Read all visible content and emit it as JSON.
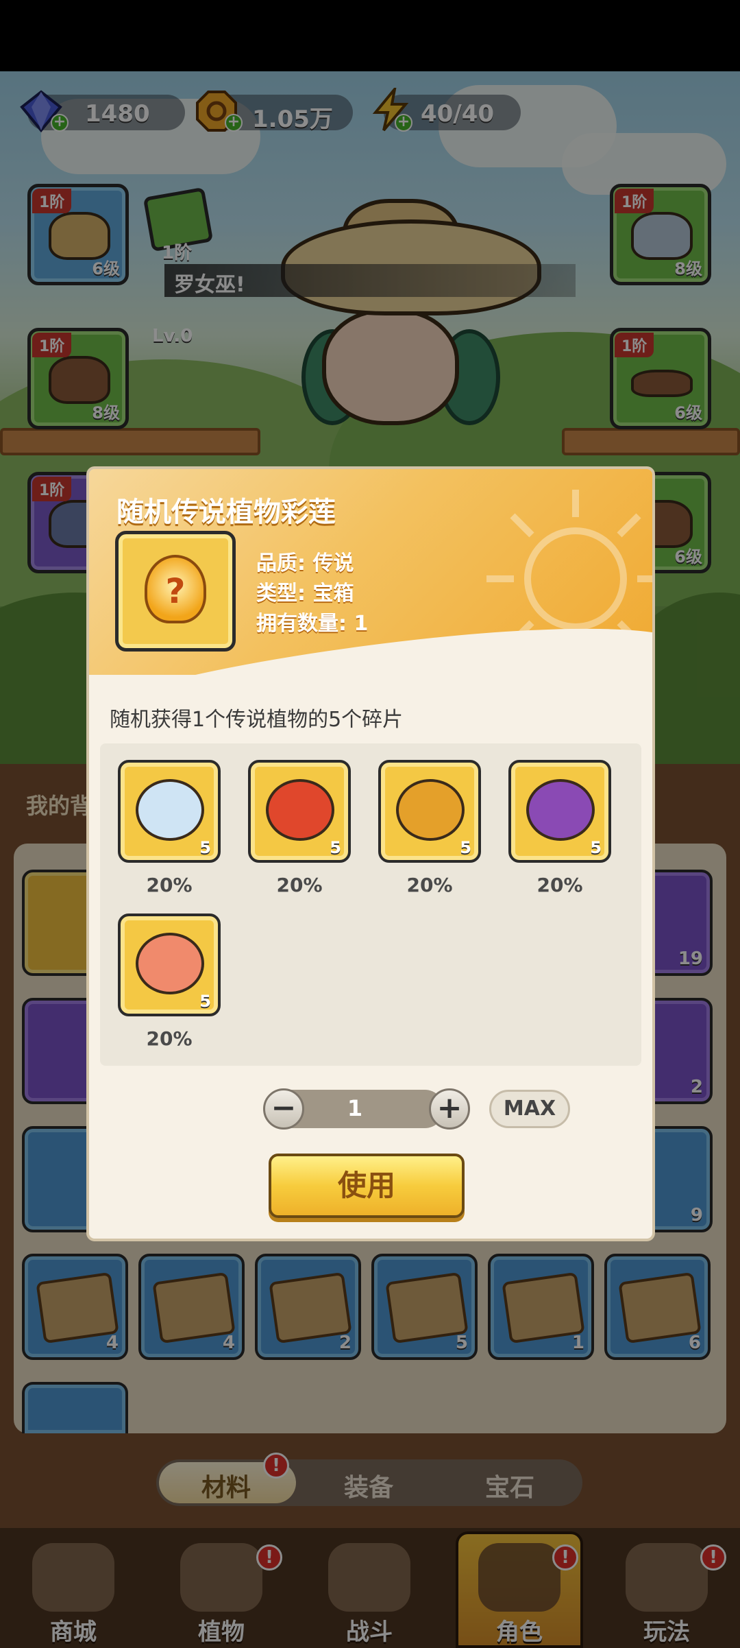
{
  "resources": {
    "diamonds": "1480",
    "coins": "1.05万",
    "energy": "40/40"
  },
  "character": {
    "name_banner": "罗女巫!",
    "side_item_tier": "1阶",
    "side_item_level": "Lv.0"
  },
  "equipment_left": [
    {
      "tier": "1阶",
      "level": "6级",
      "icon": "straw-hat-icon",
      "color": "blue"
    },
    {
      "tier": "1阶",
      "level": "8级",
      "icon": "glove-icon",
      "color": "green"
    },
    {
      "tier": "1阶",
      "level": "",
      "icon": "pants-icon",
      "color": "purple"
    }
  ],
  "equipment_right": [
    {
      "tier": "1阶",
      "level": "8级",
      "icon": "overalls-icon",
      "color": "green"
    },
    {
      "tier": "1阶",
      "level": "6级",
      "icon": "belt-icon",
      "color": "green"
    },
    {
      "tier": "",
      "level": "6级",
      "icon": "boots-icon",
      "color": "green"
    }
  ],
  "backpack": {
    "header": "我的背",
    "right_column_counts": [
      "19",
      "2",
      "9"
    ],
    "scroll_row_counts": [
      "4",
      "4",
      "2",
      "5",
      "1",
      "6"
    ]
  },
  "dialog": {
    "title": "随机传说植物彩莲",
    "quality": "品质: 传说",
    "type": "类型: 宝箱",
    "owned": "拥有数量: 1",
    "description": "随机获得1个传说植物的5个碎片",
    "rewards": [
      {
        "count": "5",
        "percent": "20%",
        "icon": "ice-spirit-icon",
        "color": "#cfe4f4"
      },
      {
        "count": "5",
        "percent": "20%",
        "icon": "chili-warrior-icon",
        "color": "#e0472c"
      },
      {
        "count": "5",
        "percent": "20%",
        "icon": "golden-knight-icon",
        "color": "#e4a02a"
      },
      {
        "count": "5",
        "percent": "20%",
        "icon": "purple-helmet-icon",
        "color": "#8a4ab4"
      },
      {
        "count": "5",
        "percent": "20%",
        "icon": "peach-creature-icon",
        "color": "#f08a6c"
      }
    ],
    "quantity": "1",
    "minus_label": "−",
    "plus_label": "+",
    "max_label": "MAX",
    "use_label": "使用"
  },
  "tabs": {
    "items": [
      "材料",
      "装备",
      "宝石"
    ],
    "active": "材料",
    "badge": "!"
  },
  "bottom_nav": [
    {
      "label": "商城",
      "badge": ""
    },
    {
      "label": "植物",
      "badge": "!"
    },
    {
      "label": "战斗",
      "badge": ""
    },
    {
      "label": "角色",
      "badge": "!"
    },
    {
      "label": "玩法",
      "badge": "!"
    }
  ],
  "colors": {
    "accent_gold": "#f3c15f",
    "badge_red": "#e0302a",
    "dialog_bg": "#f7f1e6"
  }
}
